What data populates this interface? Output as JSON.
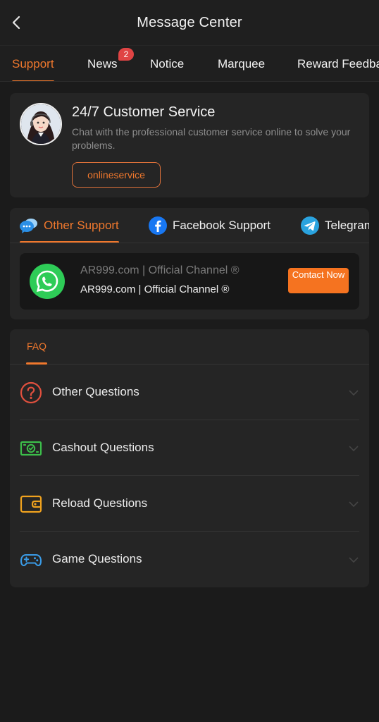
{
  "header": {
    "title": "Message Center"
  },
  "tabs": [
    {
      "label": "Support",
      "active": true
    },
    {
      "label": "News",
      "badge": "2"
    },
    {
      "label": "Notice"
    },
    {
      "label": "Marquee"
    },
    {
      "label": "Reward Feedback"
    }
  ],
  "customer_service": {
    "title": "24/7 Customer Service",
    "description": "Chat with the professional customer service online to solve your problems.",
    "button_label": "onlineservice"
  },
  "support_tabs": [
    {
      "label": "Other Support",
      "icon": "chat-bubbles-icon",
      "active": true
    },
    {
      "label": "Facebook Support",
      "icon": "facebook-icon"
    },
    {
      "label": "Telegram Support",
      "icon": "telegram-icon"
    }
  ],
  "channel": {
    "title": "AR999.com | Official Channel ®",
    "subtitle": "AR999.com | Official Channel ®",
    "button_label": "Contact Now",
    "icon": "whatsapp-icon"
  },
  "faq": {
    "tab_label": "FAQ",
    "items": [
      {
        "label": "Other Questions",
        "icon": "question-circle-icon",
        "color": "#e0503e"
      },
      {
        "label": "Cashout Questions",
        "icon": "cash-icon",
        "color": "#3cbe4a"
      },
      {
        "label": "Reload Questions",
        "icon": "wallet-icon",
        "color": "#f0a21e"
      },
      {
        "label": "Game Questions",
        "icon": "gamepad-icon",
        "color": "#3a9be6"
      }
    ]
  },
  "colors": {
    "accent": "#f0782d",
    "background": "#1b1b1b",
    "card": "#252525",
    "badge": "#e04444"
  }
}
